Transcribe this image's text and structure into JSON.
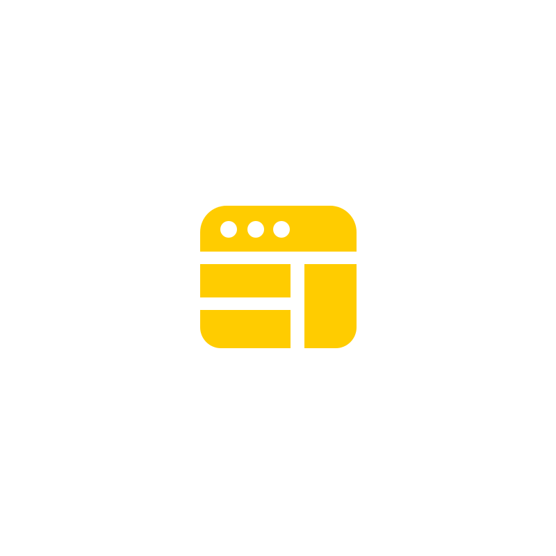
{
  "icon": {
    "name": "browser-window-layout-icon",
    "color": "#FFCC00",
    "background": "#FFFFFF"
  }
}
